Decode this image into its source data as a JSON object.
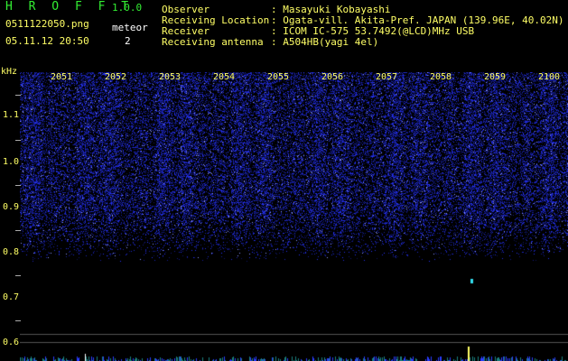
{
  "header": {
    "app_name": "H R O F F T",
    "version": "1.0.0",
    "filename": "0511122050.png",
    "datetime": "05.11.12 20:50",
    "meteor_label": "meteor",
    "meteor_count": "2"
  },
  "info": [
    {
      "key": "Observer",
      "value": ": Masayuki Kobayashi"
    },
    {
      "key": "Receiving Location",
      "value": ": Ogata-vill. Akita-Pref. JAPAN (139.96E, 40.02N)"
    },
    {
      "key": "Receiver",
      "value": ": ICOM IC-575 53.7492(@LCD)MHz USB"
    },
    {
      "key": "Receiving antenna",
      "value": ": A504HB(yagi 4el)"
    }
  ],
  "axis": {
    "unit": "kHz",
    "y_ticks": [
      "1.1",
      "1.0",
      "0.9",
      "0.8",
      "0.7",
      "0.6"
    ],
    "x_ticks": [
      "2051",
      "2052",
      "2053",
      "2054",
      "2055",
      "2056",
      "2057",
      "2058",
      "2059",
      "2100"
    ]
  },
  "colors": {
    "noise": "#2233ff",
    "highlight": "#33ddee",
    "text": "#ffff66",
    "title": "#33ee33"
  }
}
